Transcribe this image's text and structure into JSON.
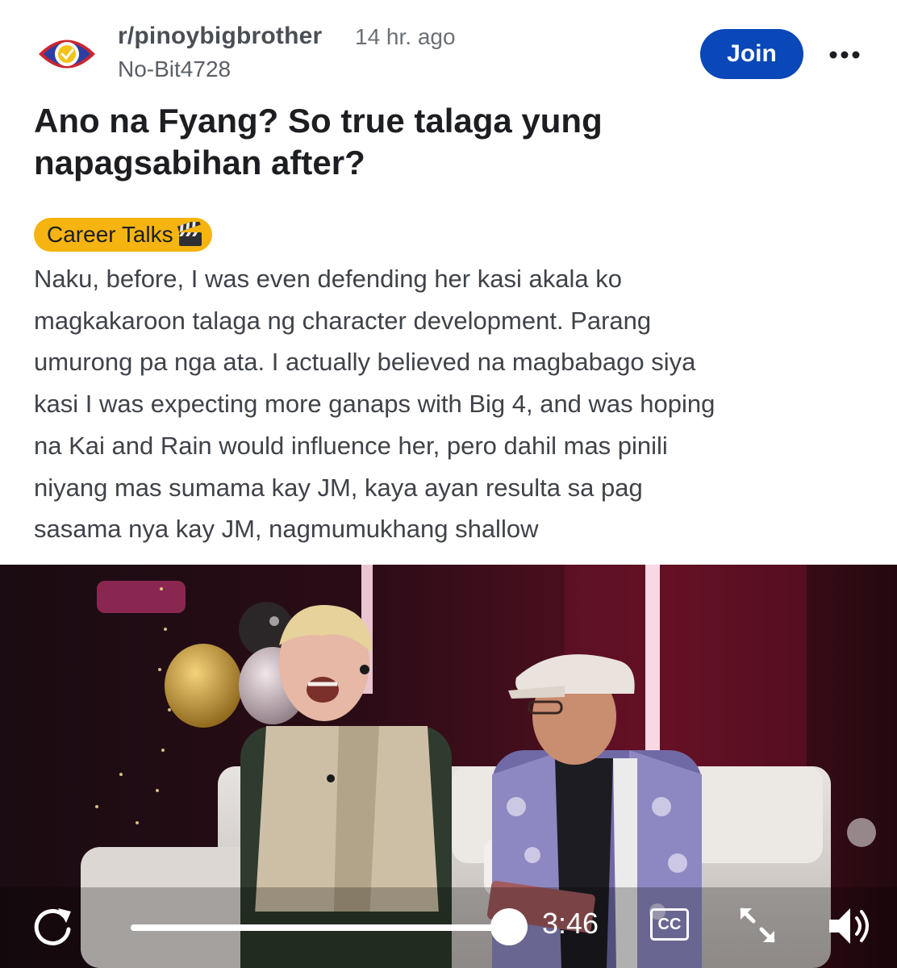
{
  "header": {
    "subreddit": "r/pinoybigbrother",
    "time_ago": "14 hr. ago",
    "author": "No-Bit4728",
    "join_label": "Join",
    "subreddit_icon": "pbb-eye-logo",
    "more_icon": "more-dots-icon"
  },
  "post": {
    "title": "Ano na Fyang? So true talaga yung napagsabihan after?",
    "flair": {
      "label": "Career Talks",
      "icon": "clapperboard-icon",
      "color": "#f5b40f"
    },
    "body": "Naku, before, I was even defending her kasi akala ko magkakaroon talaga ng character development. Parang umurong pa nga ata. I actually believed na magbabago siya kasi I was expecting more ganaps with Big 4, and was hoping na Kai and Rain would influence her, pero dahil mas pinili niyang mas sumama kay JM, kaya ayan resulta sa pag sasama nya kay JM, nagmumukhang shallow"
  },
  "video": {
    "time": "3:46",
    "progress_fraction": 0.98,
    "cc_label": "CC",
    "icons": {
      "replay": "replay-icon",
      "fullscreen": "fullscreen-icon",
      "volume": "volume-icon"
    }
  },
  "colors": {
    "join_button": "#0a47b8",
    "flair": "#f5b40f",
    "title": "#1c1e21",
    "body_text": "#3f4349"
  }
}
